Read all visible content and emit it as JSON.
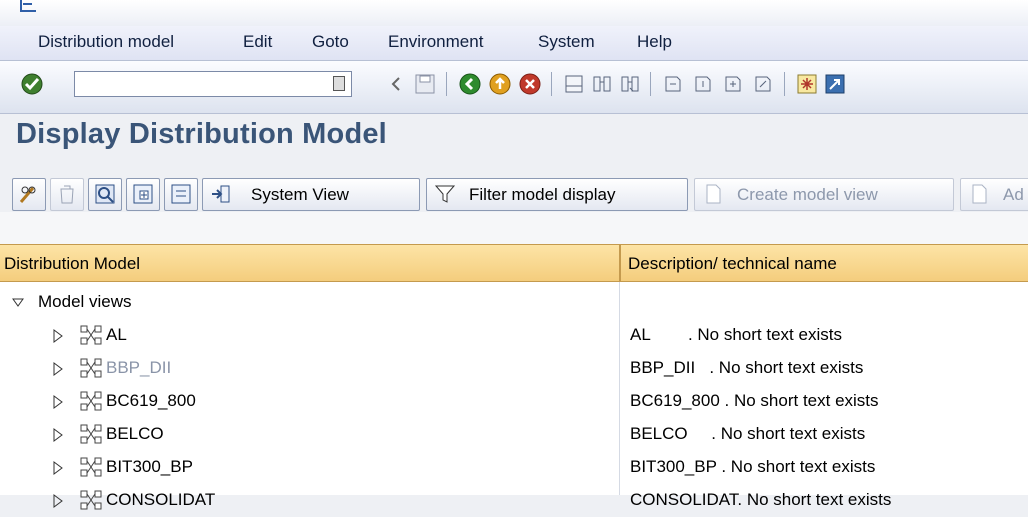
{
  "menu": [
    {
      "label": "Distribution model",
      "key": "D"
    },
    {
      "label": "Edit",
      "key": "E"
    },
    {
      "label": "Goto",
      "key": "G"
    },
    {
      "label": "Environment",
      "key": "n"
    },
    {
      "label": "System",
      "key": "y"
    },
    {
      "label": "Help",
      "key": "H"
    }
  ],
  "command_field": {
    "value": "",
    "placeholder": ""
  },
  "page": {
    "title": "Display Distribution Model"
  },
  "app_toolbar": {
    "system_view": "System View",
    "filter_model_display": "Filter model display",
    "create_model_view": "Create model view",
    "add_truncated": "Ad"
  },
  "table": {
    "col1": "Distribution Model",
    "col2": "Description/ technical name",
    "root": "Model views",
    "rows": [
      {
        "name": "AL",
        "desc": "AL        . No short text exists",
        "greyed": false
      },
      {
        "name": "BBP_DII",
        "desc": "BBP_DII   . No short text exists",
        "greyed": true
      },
      {
        "name": "BC619_800",
        "desc": "BC619_800 . No short text exists",
        "greyed": false
      },
      {
        "name": "BELCO",
        "desc": "BELCO     . No short text exists",
        "greyed": false
      },
      {
        "name": "BIT300_BP",
        "desc": "BIT300_BP . No short text exists",
        "greyed": false
      },
      {
        "name": "CONSOLIDAT",
        "desc": "CONSOLIDAT. No short text exists",
        "greyed": false
      }
    ]
  },
  "colors": {
    "title": "#3a5578",
    "header_bg": "#f4cd7d",
    "toolbar_bg": "#dde3ef"
  }
}
